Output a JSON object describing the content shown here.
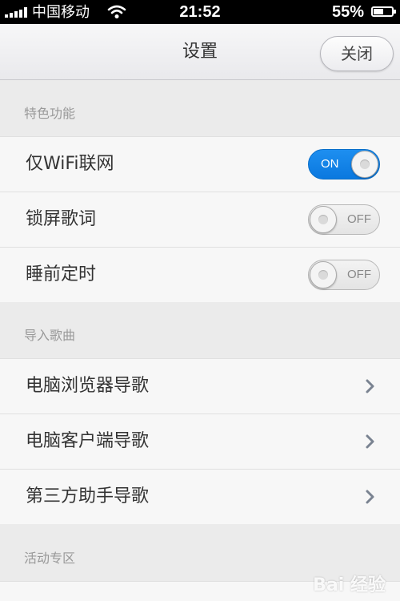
{
  "status_bar": {
    "carrier": "中国移动",
    "time": "21:52",
    "battery_percent": "55%",
    "battery_level": 0.55
  },
  "nav": {
    "title": "设置",
    "close_label": "关闭"
  },
  "sections": [
    {
      "header": "特色功能",
      "rows": [
        {
          "label": "仅WiFi联网",
          "toggle": "ON"
        },
        {
          "label": "锁屏歌词",
          "toggle": "OFF"
        },
        {
          "label": "睡前定时",
          "toggle": "OFF"
        }
      ]
    },
    {
      "header": "导入歌曲",
      "rows": [
        {
          "label": "电脑浏览器导歌"
        },
        {
          "label": "电脑客户端导歌"
        },
        {
          "label": "第三方助手导歌"
        }
      ]
    },
    {
      "header": "活动专区",
      "rows": []
    }
  ],
  "watermark": "Bai 经验",
  "colors": {
    "toggle_on": "#0a78df",
    "background": "#ebebeb",
    "row_background": "#f7f7f7"
  }
}
